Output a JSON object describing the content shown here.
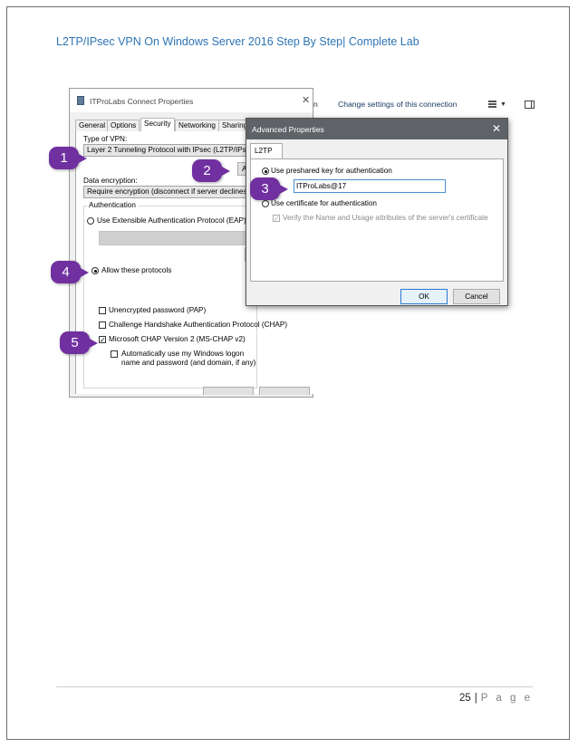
{
  "header": {
    "title": "L2TP/IPsec VPN On Windows Server 2016 Step By Step| Complete Lab"
  },
  "footer": {
    "page_number": "25",
    "separator": "|",
    "page_label": "P a g e"
  },
  "properties_window": {
    "title": "ITProLabs Connect Properties",
    "close_glyph": "✕",
    "tabs": [
      "General",
      "Options",
      "Security",
      "Networking",
      "Sharing"
    ],
    "active_tab": "Security",
    "type_of_vpn_label": "Type of VPN:",
    "type_of_vpn_value": "Layer 2 Tunneling Protocol with IPsec (L2TP/IPsec)",
    "advanced_button": "Advanced settings",
    "data_encryption_label": "Data encryption:",
    "data_encryption_value": "Require encryption (disconnect if server declines)",
    "authentication_group": "Authentication",
    "eap_option": "Use Extensible Authentication Protocol (EAP)",
    "allow_protocols_option": "Allow these protocols",
    "pap": "Unencrypted password (PAP)",
    "chap": "Challenge Handshake Authentication Protocol (CHAP)",
    "mschap": "Microsoft CHAP Version 2 (MS-CHAP v2)",
    "auto_logon": "Automatically use my Windows logon name and password (and domain, if any)",
    "pap_checked": false,
    "chap_checked": false,
    "mschap_checked": true,
    "auto_logon_checked": false
  },
  "explorer_strip": {
    "partial_text": "n",
    "link": "Change settings of this connection",
    "icons": [
      "view-options-icon",
      "dropdown-arrow-icon",
      "preview-pane-icon"
    ]
  },
  "advanced_dialog": {
    "title": "Advanced Properties",
    "close_glyph": "✕",
    "tab": "L2TP",
    "psk_option": "Use preshared key for authentication",
    "psk_key_value": "ITProLabs@17",
    "cert_option": "Use certificate for authentication",
    "verify_option": "Verify the Name and Usage attributes of the server's certificate",
    "ok_button": "OK",
    "cancel_button": "Cancel"
  },
  "callouts": [
    "1",
    "2",
    "3",
    "4",
    "5"
  ],
  "colors": {
    "header": "#2e74b5",
    "callout": "#7030a0",
    "dialog_title": "#5f6368"
  }
}
